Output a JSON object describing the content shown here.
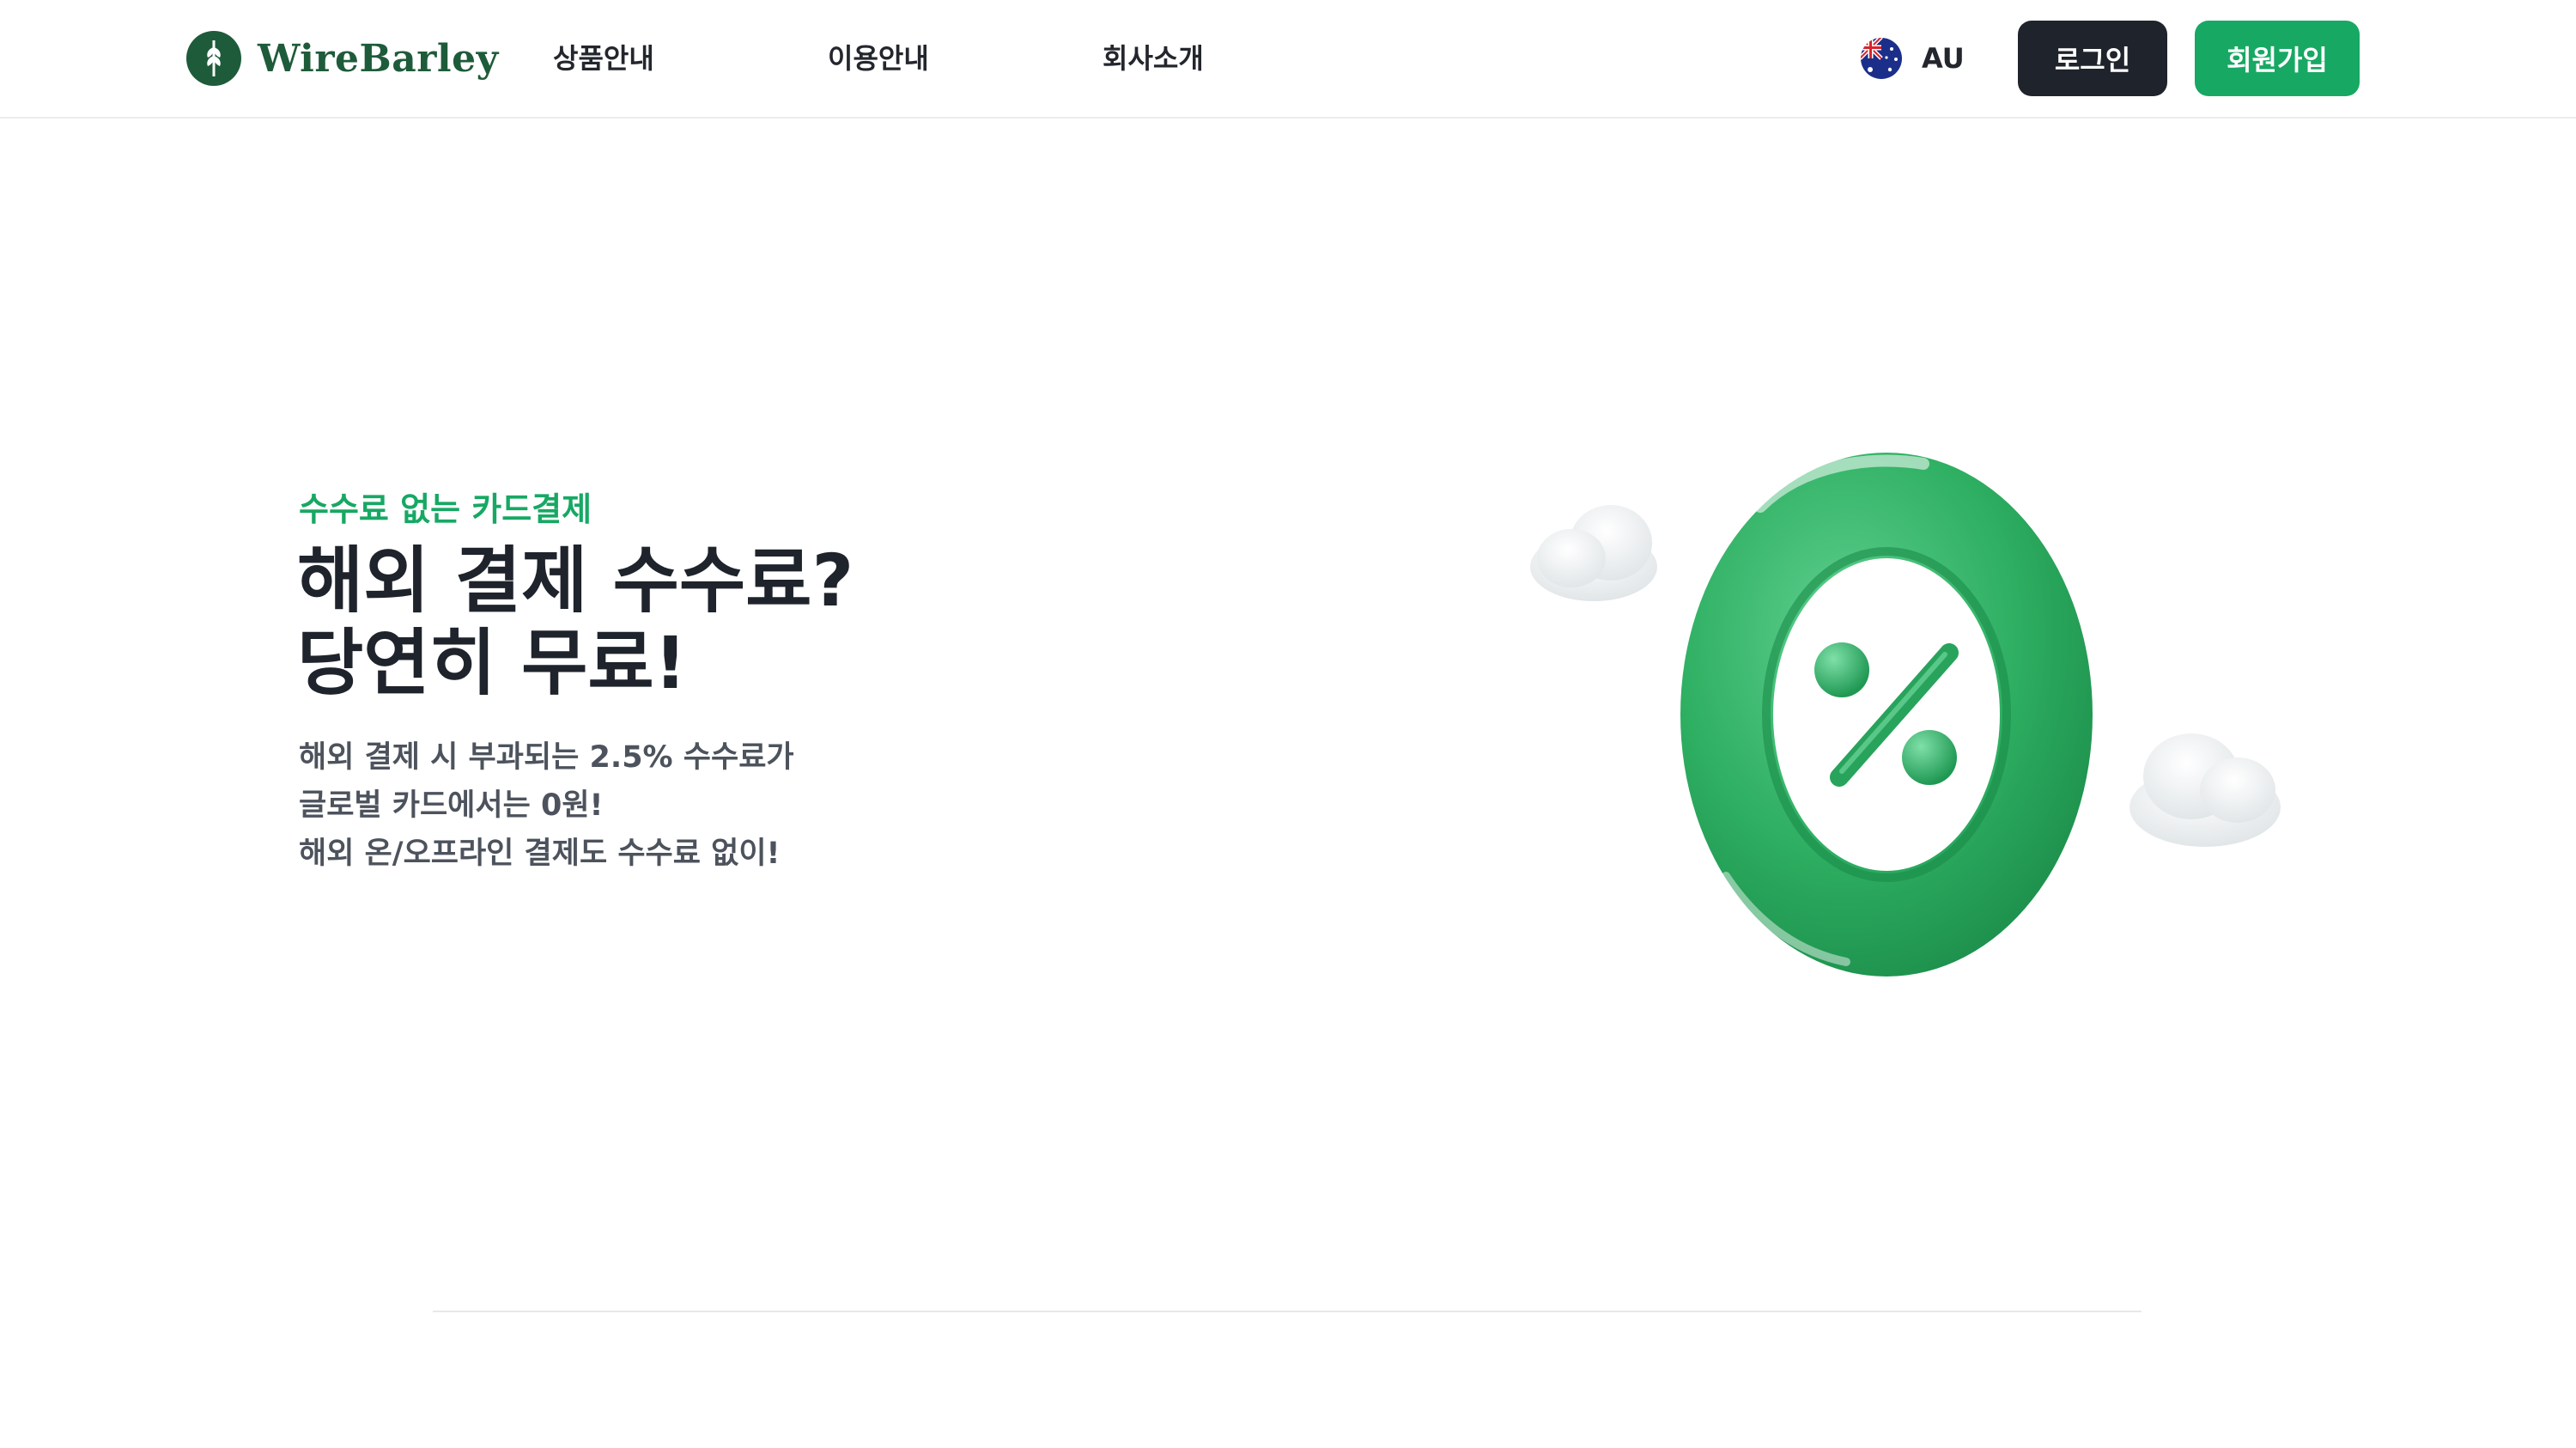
{
  "header": {
    "logo_text": "WireBarley",
    "nav": {
      "products": "상품안내",
      "guide": "이용안내",
      "company": "회사소개"
    },
    "country_code": "AU",
    "login_label": "로그인",
    "signup_label": "회원가입"
  },
  "hero": {
    "eyebrow": "수수료 없는 카드결제",
    "title_line1": "해외 결제 수수료?",
    "title_line2": "당연히 무료!",
    "desc_line1": "해외 결제 시 부과되는 2.5% 수수료가",
    "desc_line2": "글로벌 카드에서는 0원!",
    "desc_line3": "해외 온/오프라인 결제도 수수료 없이!"
  },
  "colors": {
    "brand_green": "#17a864",
    "dark": "#1f232b",
    "logo_green": "#1e5b3a"
  },
  "icons": {
    "logo": "wheat-leaf-logo",
    "flag": "australia-flag-icon",
    "illustration": "zero-percent-3d-illustration"
  }
}
